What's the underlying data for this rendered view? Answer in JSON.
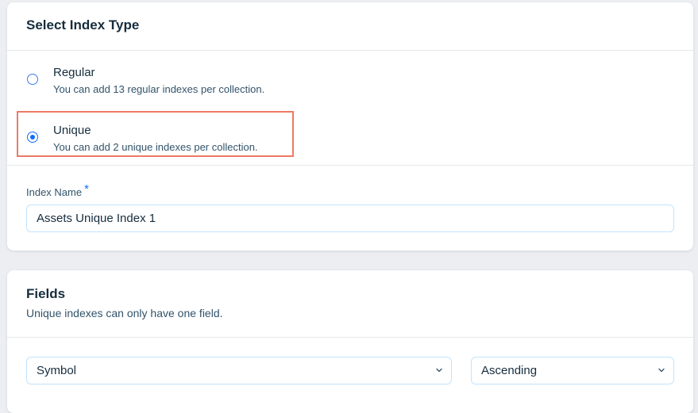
{
  "index_type": {
    "title": "Select Index Type",
    "options": [
      {
        "label": "Regular",
        "description": "You can add 13 regular indexes per collection.",
        "selected": false
      },
      {
        "label": "Unique",
        "description": "You can add 2 unique indexes per collection.",
        "selected": true
      }
    ],
    "index_name_label": "Index Name",
    "required_marker": "*",
    "index_name_value": "Assets Unique Index 1"
  },
  "fields": {
    "title": "Fields",
    "subtitle": "Unique indexes can only have one field.",
    "field_select_value": "Symbol",
    "order_select_value": "Ascending"
  },
  "colors": {
    "accent": "#116dff",
    "highlight_border": "#ec7a63",
    "background": "#eceef2",
    "text": "#162d3d"
  }
}
